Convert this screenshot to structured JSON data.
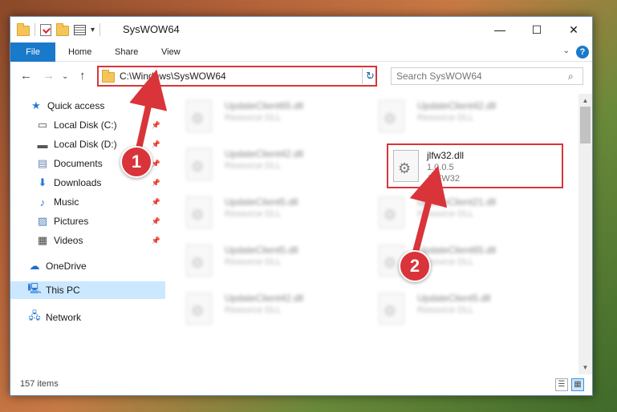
{
  "window": {
    "title": "SysWOW64",
    "controls": {
      "minimize": "—",
      "maximize": "☐",
      "close": "✕"
    }
  },
  "ribbon": {
    "tabs": [
      "File",
      "Home",
      "Share",
      "View"
    ],
    "help": "?"
  },
  "address": {
    "path": "C:\\Windows\\SysWOW64",
    "search_placeholder": "Search SysWOW64"
  },
  "sidebar": {
    "quick_access": "Quick access",
    "items": [
      "Local Disk (C:)",
      "Local Disk (D:)",
      "Documents",
      "Downloads",
      "Music",
      "Pictures",
      "Videos"
    ],
    "onedrive": "OneDrive",
    "this_pc": "This PC",
    "network": "Network"
  },
  "files": [
    {
      "name": "UpdateClient65.dll",
      "desc": "Resource DLL"
    },
    {
      "name": "UpdateClient42.dll",
      "desc": "Resource DLL"
    },
    {
      "name": "UpdateClient42.dll",
      "desc": "Resource DLL"
    },
    {
      "name": "UpdateClient5.dll",
      "desc": "Resource DLL"
    },
    {
      "name": "UpdateClient21.dll",
      "desc": "Resource DLL"
    },
    {
      "name": "UpdateClient5.dll",
      "desc": "Resource DLL"
    },
    {
      "name": "UpdateClient65.dll",
      "desc": "Resource DLL"
    },
    {
      "name": "UpdateClient42.dll",
      "desc": "Resource DLL"
    },
    {
      "name": "UpdateClient5.dll",
      "desc": "Resource DLL"
    }
  ],
  "highlighted_file": {
    "name": "jlfw32.dll",
    "version": "1.0.0.5",
    "description": "JLFW32"
  },
  "status": {
    "count": "157 items"
  },
  "markers": [
    "1",
    "2"
  ],
  "colors": {
    "accent": "#1979ca",
    "highlight": "#d9343a",
    "selected": "#cce8ff"
  }
}
